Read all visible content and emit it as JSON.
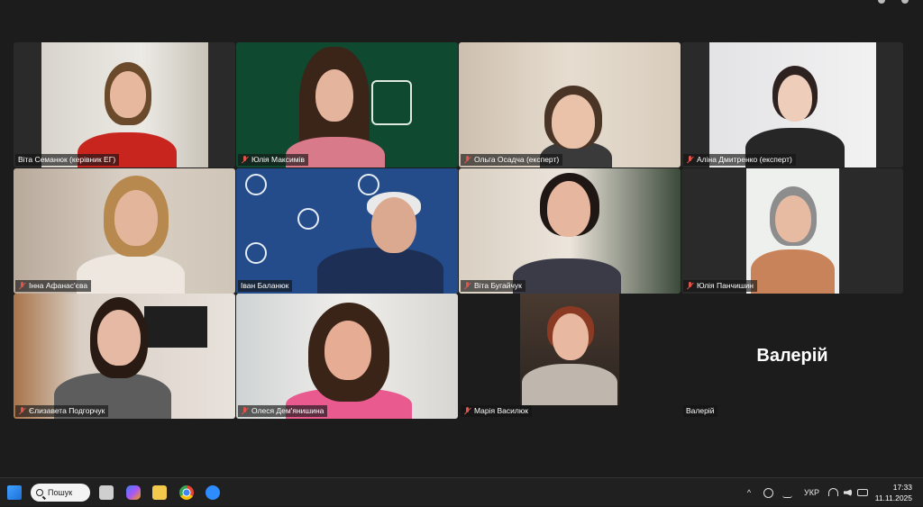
{
  "meeting": {
    "participants": [
      {
        "name": "Віта Семанюк (керівник ЕГ)",
        "muted": false
      },
      {
        "name": "Юлія Максимів",
        "muted": true
      },
      {
        "name": "Ольга Осадча (експерт)",
        "muted": true
      },
      {
        "name": "Аліна Дмитренко (експерт)",
        "muted": true
      },
      {
        "name": "Інна Афанас'єва",
        "muted": true
      },
      {
        "name": "Іван Баланюк",
        "muted": false
      },
      {
        "name": "Віта Бугайчук",
        "muted": true
      },
      {
        "name": "Юлія Панчишин",
        "muted": true
      },
      {
        "name": "Єлизавета Подгорчук",
        "muted": true
      },
      {
        "name": "Олеся Дем'янишина",
        "muted": true
      },
      {
        "name": "Марія Василюк",
        "muted": true
      },
      {
        "name": "Валерій",
        "muted": false
      }
    ],
    "no_video_display_name": "Валерій",
    "active_speaker": "Іван Баланюк"
  },
  "taskbar": {
    "search_label": "Пошук",
    "language": "УКР",
    "time": "17:33",
    "date": "11.11.2025"
  },
  "colors": {
    "active_speaker_border": "#4ecb71",
    "muted_mic": "#e0544b",
    "meeting_background": "#1c1c1c"
  }
}
